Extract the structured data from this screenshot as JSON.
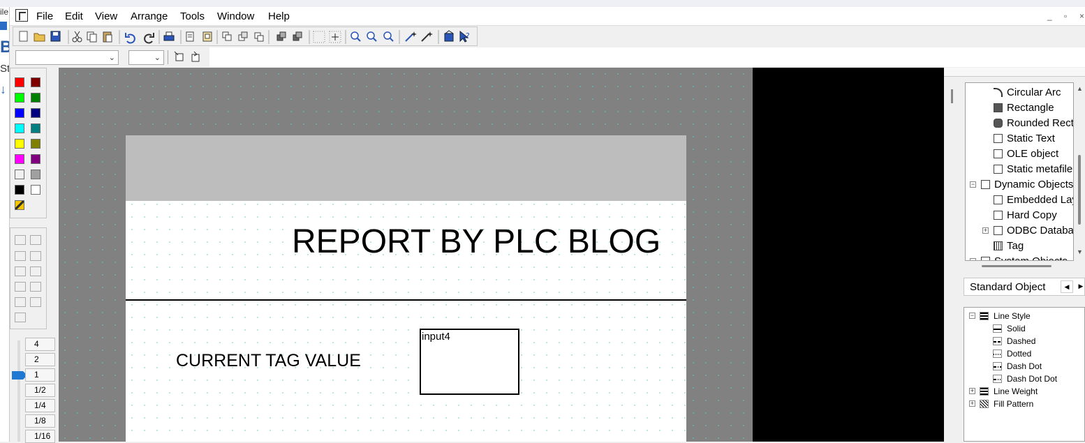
{
  "menubar": {
    "items": [
      "File",
      "Edit",
      "View",
      "Arrange",
      "Tools",
      "Window",
      "Help"
    ],
    "window_controls": [
      "minimize",
      "restore",
      "close"
    ]
  },
  "left_sliver": {
    "fragments": [
      "ile",
      "B",
      "St"
    ]
  },
  "toolbar": {
    "icons": [
      "new-icon",
      "open-icon",
      "save-icon",
      "cut-icon",
      "copy-icon",
      "paste-icon",
      "undo-icon",
      "redo-icon",
      "print-icon",
      "page-setup-icon",
      "preview-icon",
      "bring-front-icon",
      "send-back-icon",
      "duplicate-icon",
      "group-icon",
      "ungroup-icon",
      "grid-icon",
      "snap-icon",
      "zoom-in-icon",
      "zoom-out-icon",
      "zoom-fit-icon",
      "wand-icon",
      "wand-alt-icon",
      "properties-icon",
      "help-pointer-icon"
    ]
  },
  "toolbar2": {
    "font_combo_value": "",
    "size_combo_value": ""
  },
  "palette": {
    "colors": [
      "#ff0000",
      "#800000",
      "#00ff00",
      "#008000",
      "#0000ff",
      "#000080",
      "#00ffff",
      "#008080",
      "#ffff00",
      "#808000",
      "#ff00ff",
      "#800080",
      "#f0f0f0",
      "#a0a0a0",
      "#000000",
      "#ffffff"
    ]
  },
  "zoom": {
    "levels": [
      "4",
      "2",
      "1",
      "1/2",
      "1/4",
      "1/8",
      "1/16"
    ],
    "selected": "1"
  },
  "report": {
    "title": "REPORT BY PLC BLOG",
    "tag_label": "CURRENT TAG VALUE",
    "input_field": "input4"
  },
  "object_tree": {
    "items": [
      {
        "label": "Circular Arc",
        "icon": "arc-icon",
        "level": 2
      },
      {
        "label": "Rectangle",
        "icon": "rectangle-icon",
        "level": 2
      },
      {
        "label": "Rounded Rect",
        "icon": "rounded-rect-icon",
        "level": 2
      },
      {
        "label": "Static Text",
        "icon": "static-text-icon",
        "level": 2
      },
      {
        "label": "OLE object",
        "icon": "ole-icon",
        "level": 2
      },
      {
        "label": "Static metafile",
        "icon": "metafile-icon",
        "level": 2
      },
      {
        "label": "Dynamic Objects",
        "icon": "dynamic-objects-icon",
        "level": 1
      },
      {
        "label": "Embedded Lay",
        "icon": "embedded-layout-icon",
        "level": 2
      },
      {
        "label": "Hard Copy",
        "icon": "hard-copy-icon",
        "level": 2
      },
      {
        "label": "ODBC Databa",
        "icon": "odbc-icon",
        "level": 2
      },
      {
        "label": "Tag",
        "icon": "tag-icon",
        "level": 2
      },
      {
        "label": "System Objects",
        "icon": "system-objects-icon",
        "level": 1
      }
    ],
    "tab_label": "Standard Object"
  },
  "style_tree": {
    "items": [
      {
        "label": "Line Style",
        "level": 1,
        "expanded": true
      },
      {
        "label": "Solid",
        "level": 2,
        "style": "solid"
      },
      {
        "label": "Dashed",
        "level": 2,
        "style": "dashed"
      },
      {
        "label": "Dotted",
        "level": 2,
        "style": "dotted"
      },
      {
        "label": "Dash Dot",
        "level": 2,
        "style": "dashdot"
      },
      {
        "label": "Dash Dot Dot",
        "level": 2,
        "style": "dashdotdot"
      },
      {
        "label": "Line Weight",
        "level": 1,
        "expanded": false
      },
      {
        "label": "Fill Pattern",
        "level": 1,
        "expanded": false
      }
    ]
  }
}
